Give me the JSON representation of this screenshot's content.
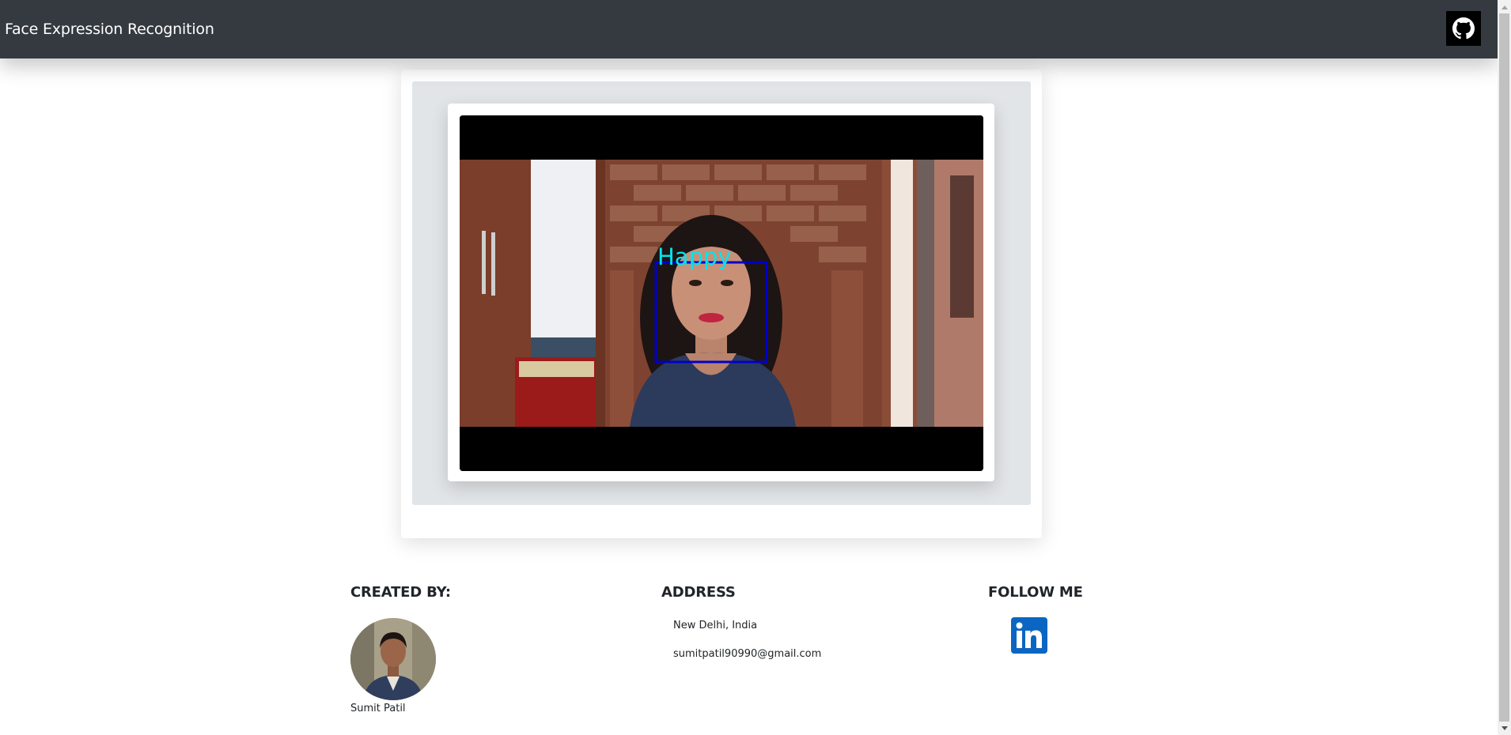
{
  "navbar": {
    "brand": "Face Expression Recognition",
    "github_icon": "github-icon",
    "background": "#343a40"
  },
  "video": {
    "expression_label": "Happy",
    "label_color": "#00e5ee",
    "box_color": "#0000cc"
  },
  "footer": {
    "created_by": {
      "heading": "CREATED BY:",
      "name": "Sumit Patil"
    },
    "address": {
      "heading": "ADDRESS",
      "city": "New Delhi, India",
      "email": "sumitpatil90990@gmail.com"
    },
    "follow": {
      "heading": "FOLLOW ME",
      "icon": "linkedin-icon",
      "color": "#0a66c2"
    }
  }
}
